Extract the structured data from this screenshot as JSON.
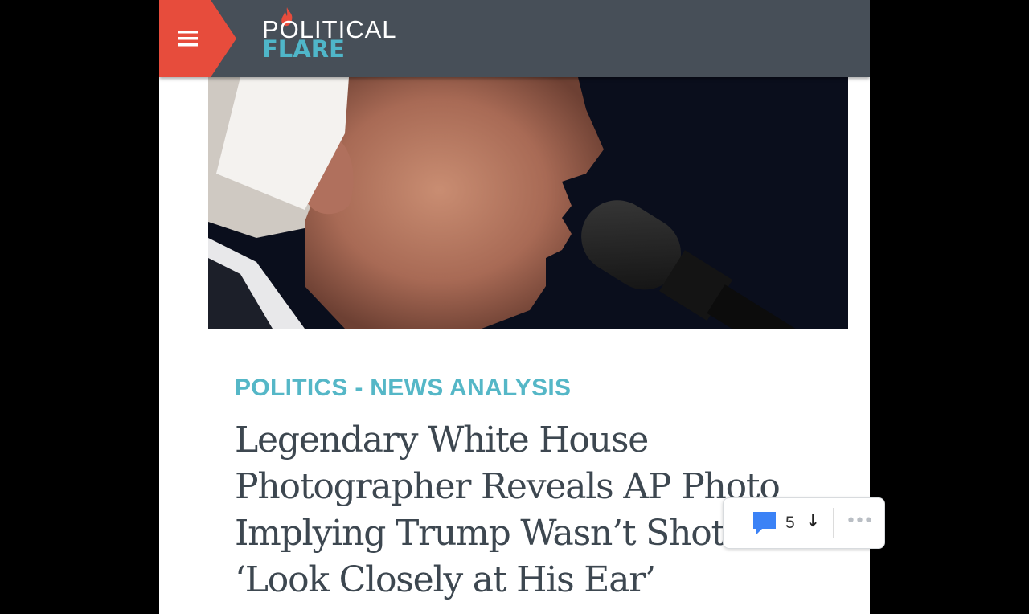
{
  "header": {
    "menu_icon": "hamburger-menu-icon",
    "logo_top": "POLITICAL",
    "logo_bottom": "FLARE",
    "logo_icon": "flame-icon",
    "colors": {
      "bar": "#474f58",
      "menu_button": "#e74c3c",
      "accent": "#4fb6c9"
    }
  },
  "article": {
    "image_alt": "Close-up of Donald Trump with bandage on ear speaking into microphone",
    "category": "POLITICS - NEWS ANALYSIS",
    "headline_lines": [
      "Legendary White House",
      "Photographer Reveals AP Photo",
      "Implying Trump Wasn’t Shot:",
      "‘Look Closely at His Ear’"
    ]
  },
  "comments_bar": {
    "icon": "comment-bubble-icon",
    "count": "5",
    "arrow": "↓",
    "more": "•••"
  }
}
